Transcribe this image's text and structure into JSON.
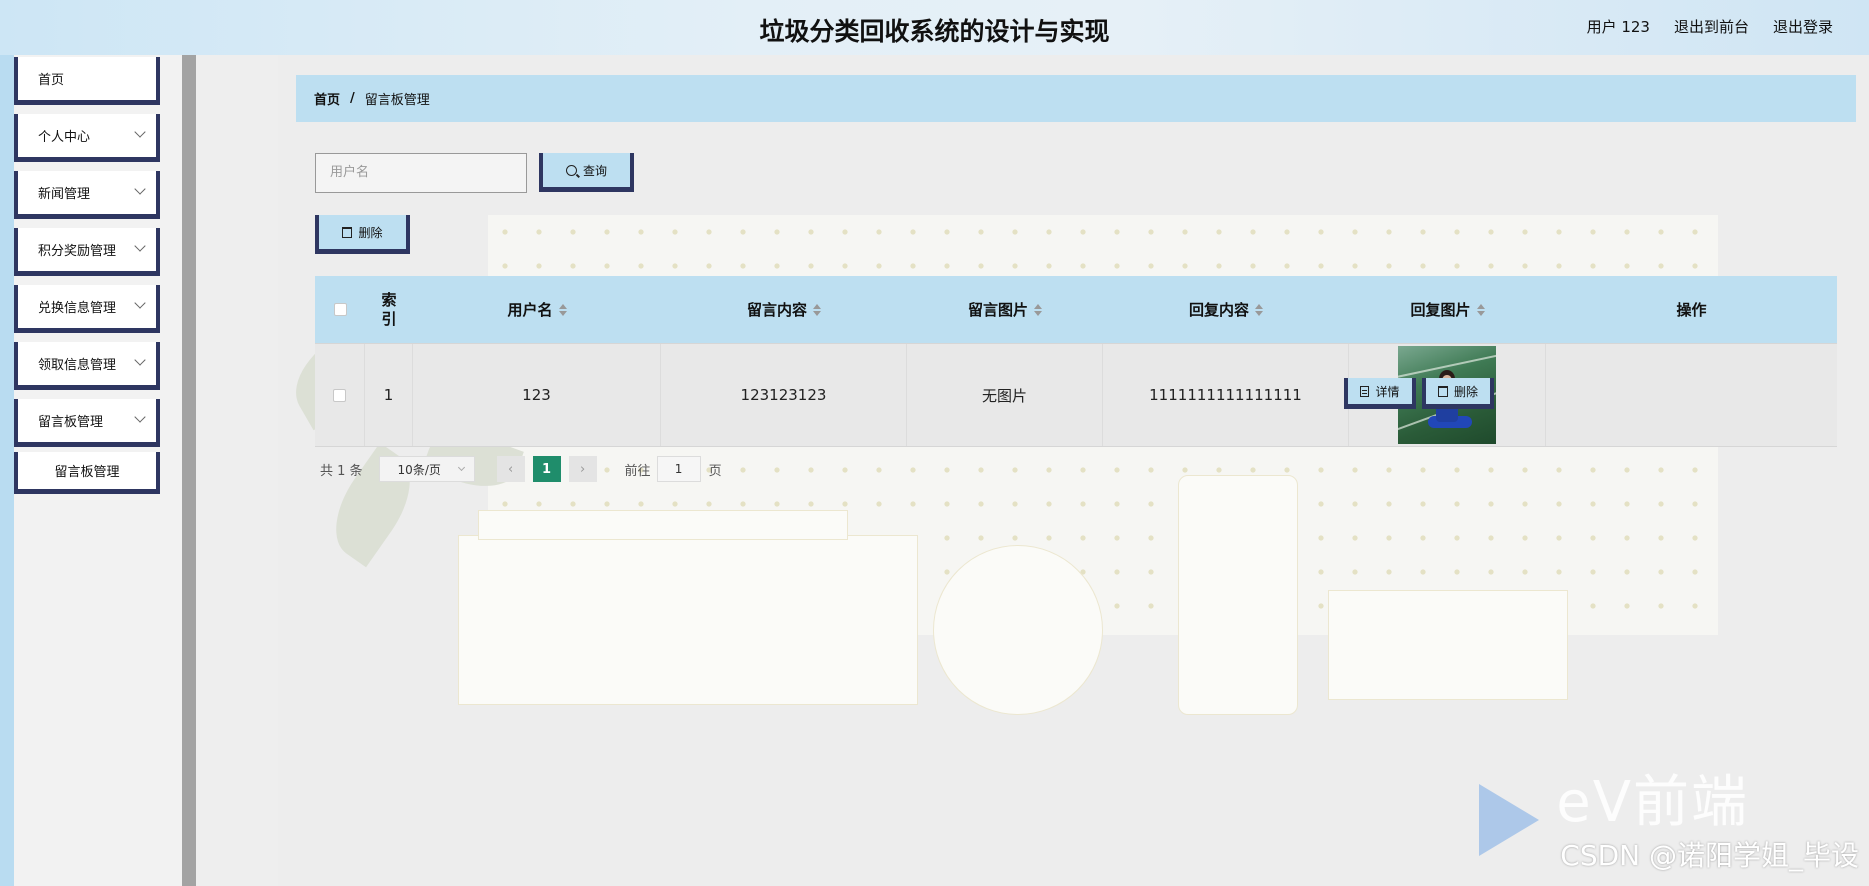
{
  "header": {
    "title": "垃圾分类回收系统的设计与实现",
    "user_label": "用户 123",
    "front_label": "退出到前台",
    "logout_label": "退出登录"
  },
  "sidebar": {
    "items": [
      {
        "label": "首页"
      },
      {
        "label": "个人中心"
      },
      {
        "label": "新闻管理"
      },
      {
        "label": "积分奖励管理"
      },
      {
        "label": "兑换信息管理"
      },
      {
        "label": "领取信息管理"
      },
      {
        "label": "留言板管理"
      }
    ],
    "sub_item": "留言板管理"
  },
  "breadcrumb": {
    "home": "首页",
    "separator": "/",
    "current": "留言板管理"
  },
  "search": {
    "placeholder": "用户名",
    "button": "查询"
  },
  "actions": {
    "delete": "删除"
  },
  "table": {
    "headers": {
      "index": "索引",
      "username": "用户名",
      "content": "留言内容",
      "image": "留言图片",
      "reply": "回复内容",
      "reply_image": "回复图片",
      "ops": "操作"
    },
    "rows": [
      {
        "index": "1",
        "username": "123",
        "content": "123123123",
        "image": "无图片",
        "reply": "1111111111111111",
        "detail_btn": "详情",
        "delete_btn": "删除"
      }
    ]
  },
  "pagination": {
    "total": "共 1 条",
    "page_size": "10条/页",
    "prev": "‹",
    "current_page": "1",
    "next": "›",
    "goto_label": "前往",
    "goto_value": "1",
    "page_suffix": "页"
  },
  "watermark": {
    "brand": "eV前端",
    "credit": "CSDN @诺阳学姐_毕设"
  }
}
